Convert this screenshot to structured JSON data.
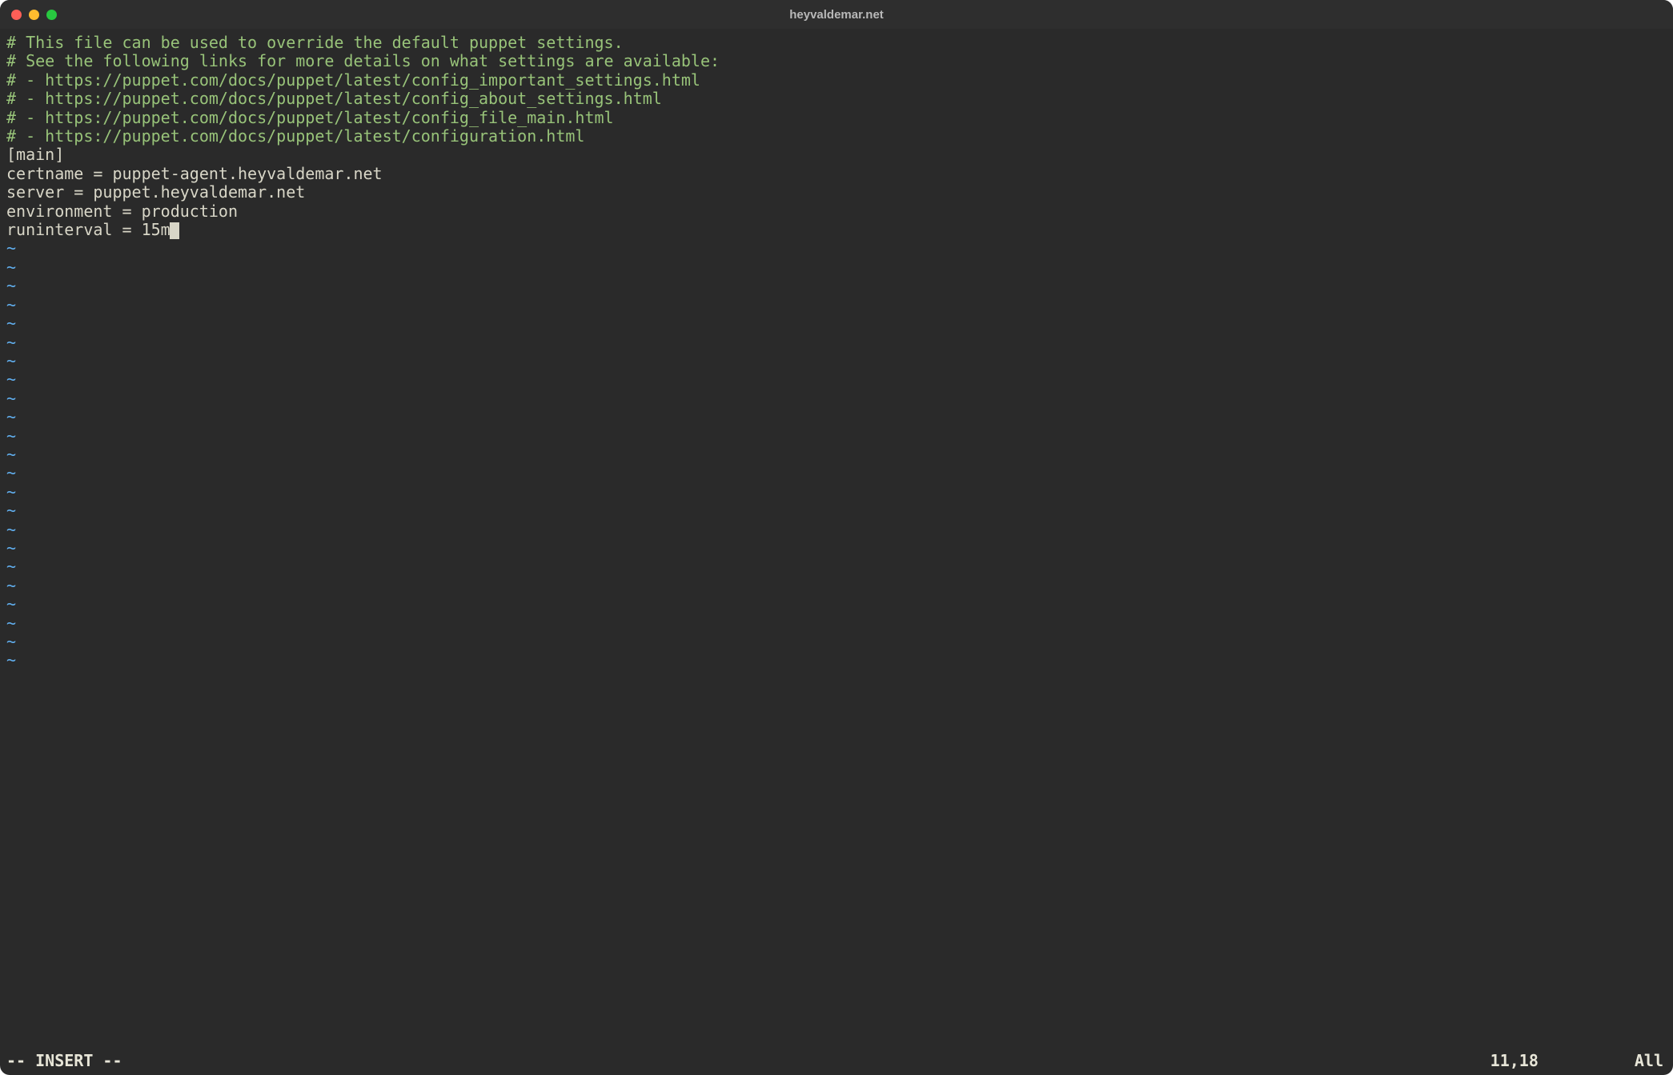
{
  "window": {
    "title": "heyvaldemar.net"
  },
  "file": {
    "lines": [
      {
        "type": "comment",
        "text": "# This file can be used to override the default puppet settings."
      },
      {
        "type": "comment",
        "text": "# See the following links for more details on what settings are available:"
      },
      {
        "type": "comment",
        "text": "# - https://puppet.com/docs/puppet/latest/config_important_settings.html"
      },
      {
        "type": "comment",
        "text": "# - https://puppet.com/docs/puppet/latest/config_about_settings.html"
      },
      {
        "type": "comment",
        "text": "# - https://puppet.com/docs/puppet/latest/config_file_main.html"
      },
      {
        "type": "comment",
        "text": "# - https://puppet.com/docs/puppet/latest/configuration.html"
      },
      {
        "type": "plain",
        "text": "[main]"
      },
      {
        "type": "plain",
        "text": "certname = puppet-agent.heyvaldemar.net"
      },
      {
        "type": "plain",
        "text": "server = puppet.heyvaldemar.net"
      },
      {
        "type": "plain",
        "text": "environment = production"
      },
      {
        "type": "plain",
        "text": "runinterval = 15m",
        "cursor_after": true
      }
    ]
  },
  "empty_tilde_count": 23,
  "tilde_char": "~",
  "status": {
    "mode": "-- INSERT --",
    "position": "11,18",
    "percent": "All"
  }
}
